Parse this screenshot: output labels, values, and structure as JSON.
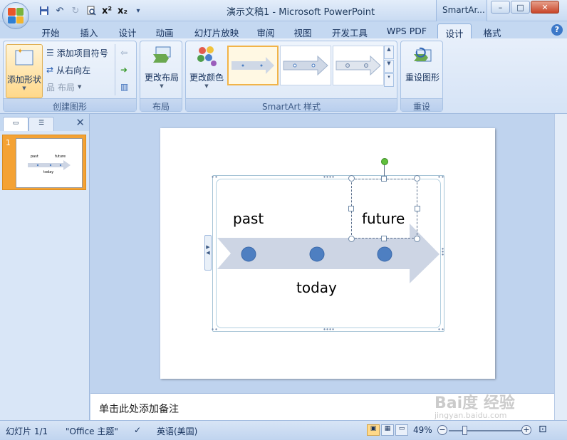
{
  "window": {
    "title": "演示文稿1 - Microsoft PowerPoint",
    "context_tab_title": "SmartAr...",
    "controls": {
      "minimize": "–",
      "maximize": "□",
      "close": "✕"
    }
  },
  "quick_access": [
    "save-icon",
    "undo-icon",
    "redo-icon",
    "print-preview-icon",
    "superscript-icon",
    "subscript-icon"
  ],
  "quick_access_text": {
    "superscript": "x²",
    "subscript": "x₂",
    "dropdown": "▾"
  },
  "tabs": [
    {
      "label": "开始",
      "active": false
    },
    {
      "label": "插入",
      "active": false
    },
    {
      "label": "设计",
      "active": false
    },
    {
      "label": "动画",
      "active": false
    },
    {
      "label": "幻灯片放映",
      "active": false
    },
    {
      "label": "审阅",
      "active": false
    },
    {
      "label": "视图",
      "active": false
    },
    {
      "label": "开发工具",
      "active": false
    },
    {
      "label": "WPS PDF",
      "active": false
    },
    {
      "label": "设计",
      "active": true
    },
    {
      "label": "格式",
      "active": false
    }
  ],
  "help_label": "?",
  "ribbon": {
    "create_graphic": {
      "label": "创建图形",
      "add_shape": "添加形状",
      "add_bullet": "添加项目符号",
      "right_to_left": "从右向左",
      "layout": "布局"
    },
    "layouts": {
      "label": "布局",
      "change_layout": "更改布局"
    },
    "smartart_styles": {
      "label": "SmartArt 样式",
      "change_colors": "更改颜色",
      "selected_index": 0,
      "item_count": 3
    },
    "reset": {
      "label": "重设",
      "reset_graphic": "重设图形"
    }
  },
  "left_pane": {
    "slide_number": "1"
  },
  "slide": {
    "items": {
      "past": "past",
      "future": "future",
      "today": "today"
    },
    "colors": {
      "arrow": "#cdd5e4",
      "dot": "#4e7fc1",
      "dot_border": "#3c6aab"
    }
  },
  "notes": {
    "placeholder": "单击此处添加备注"
  },
  "watermark": {
    "brand": "Bai度 经验",
    "url": "jingyan.baidu.com"
  },
  "statusbar": {
    "slide_info": "幻灯片 1/1",
    "theme": "\"Office 主题\"",
    "language": "英语(美国)",
    "zoom": "49%",
    "zoom_level": 49
  }
}
